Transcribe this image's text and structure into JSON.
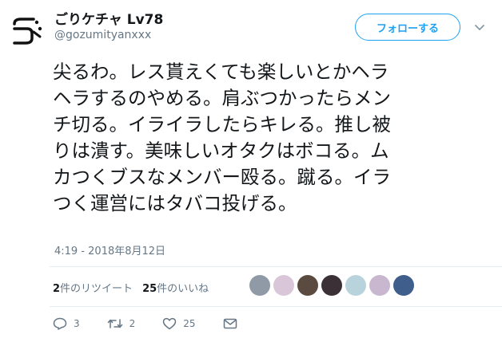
{
  "author": {
    "display_name": "ごりケチャ Lv78",
    "handle": "@gozumityanxxx"
  },
  "follow_button_label": "フォローする",
  "tweet_lines": [
    "尖るわ。レス貰えくても楽しいとかヘラ",
    "ヘラするのやめる。肩ぶつかったらメン",
    "チ切る。イライラしたらキレる。推し被",
    "りは潰す。美味しいオタクはボコる。ム",
    "カつくブスなメンバー殴る。蹴る。イラ",
    "つく運営にはタバコ投げる。"
  ],
  "timestamp": "4:19 - 2018年8月12日",
  "stats": {
    "retweet_count": "2",
    "retweet_label": "件のリツイート",
    "like_count": "25",
    "like_label": "件のいいね"
  },
  "liker_avatars": [
    {
      "name": "liker-1",
      "color": "#8f9aa6"
    },
    {
      "name": "liker-2",
      "color": "#d9c6d8"
    },
    {
      "name": "liker-3",
      "color": "#5a4a3f"
    },
    {
      "name": "liker-4",
      "color": "#3a3036"
    },
    {
      "name": "liker-5",
      "color": "#b9d3dd"
    },
    {
      "name": "liker-6",
      "color": "#c9b7cf"
    },
    {
      "name": "liker-7",
      "color": "#3f5e8c"
    }
  ],
  "actions": {
    "reply_count": "3",
    "retweet_count": "2",
    "like_count": "25"
  }
}
